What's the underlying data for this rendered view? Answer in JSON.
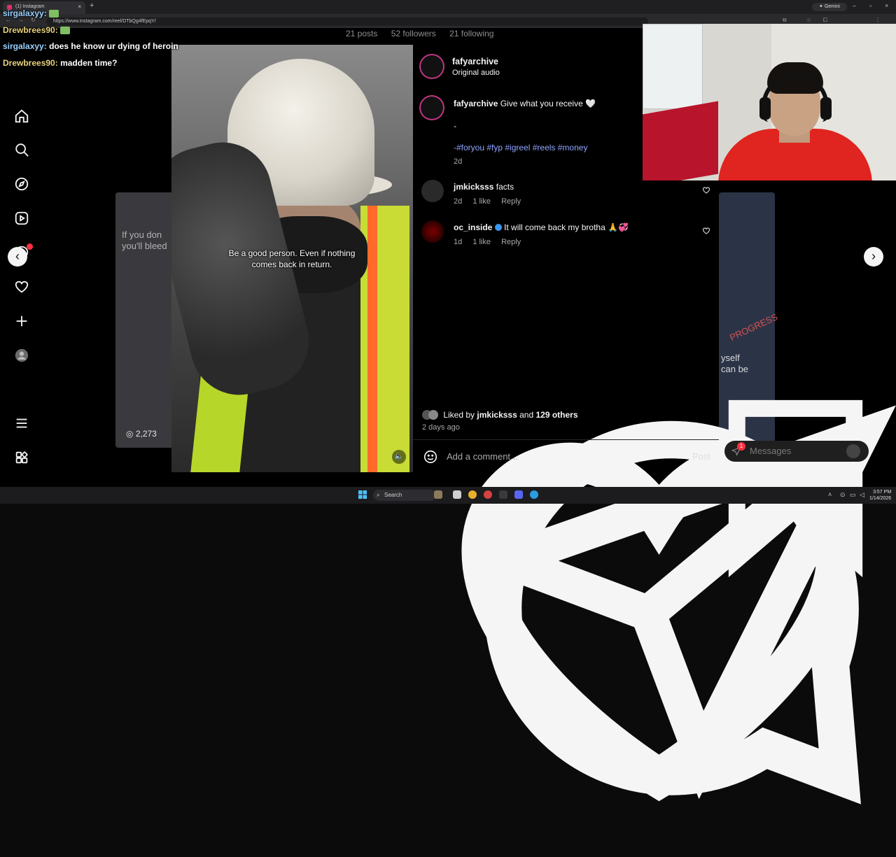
{
  "browser": {
    "tab_title": "(1) Instagram",
    "url": "https://www.instagram.com/reel/DTbQg4fEpqY/",
    "gemini_label": "Gemini",
    "new_tab_symbol": "+",
    "tab_close": "×",
    "minimize": "–",
    "restore": "▫",
    "close": "×"
  },
  "profile_stats": {
    "posts": "21 posts",
    "followers": "52 followers",
    "following": "21 following"
  },
  "chat": [
    {
      "user": "sirgalaxyy:",
      "message": ""
    },
    {
      "user": "Drewbrees90:",
      "message": ""
    },
    {
      "user": "sirgalaxyy:",
      "message": "does he know ur dying of heroin"
    },
    {
      "user": "Drewbrees90:",
      "message": "madden time?"
    }
  ],
  "reel": {
    "caption_overlay": "Be a good person. Even if nothing comes back in return.",
    "speaker_icon": "🔈"
  },
  "side_cards": {
    "left_text": "If you don\nyou'll bleed",
    "left_views": "2,273",
    "right_text": "yself\ncan be",
    "right_banner": "PROGRESS"
  },
  "post": {
    "author": "fafyarchive",
    "audio": "Original audio",
    "caption_user": "fafyarchive",
    "caption_text": "Give what you receive 🤍",
    "caption_dash": "-",
    "hashtags": "-#foryou #fyp #igreel #reels #money",
    "caption_age": "2d",
    "comments": [
      {
        "user": "jmkicksss",
        "text": "facts",
        "age": "2d",
        "likes": "1 like",
        "reply": "Reply"
      },
      {
        "user": "oc_inside",
        "text": "It will come back my brotha 🙏💞",
        "age": "1d",
        "likes": "1 like",
        "reply": "Reply"
      }
    ],
    "liked_by_prefix": "Liked by",
    "liked_by_user": "jmkicksss",
    "liked_by_and": "and",
    "liked_by_others": "129 others",
    "posted_ago": "2 days ago",
    "comment_placeholder": "Add a comment...",
    "post_button": "Post"
  },
  "messages_pill": {
    "label": "Messages",
    "badge": "1"
  },
  "taskbar": {
    "search_label": "Search",
    "time": "3:57 PM",
    "date": "1/14/2026"
  },
  "colors": {
    "instagram_ring": "#c13584",
    "hashtag_blue": "#8fa6ff",
    "notify_red": "#ff3040"
  }
}
